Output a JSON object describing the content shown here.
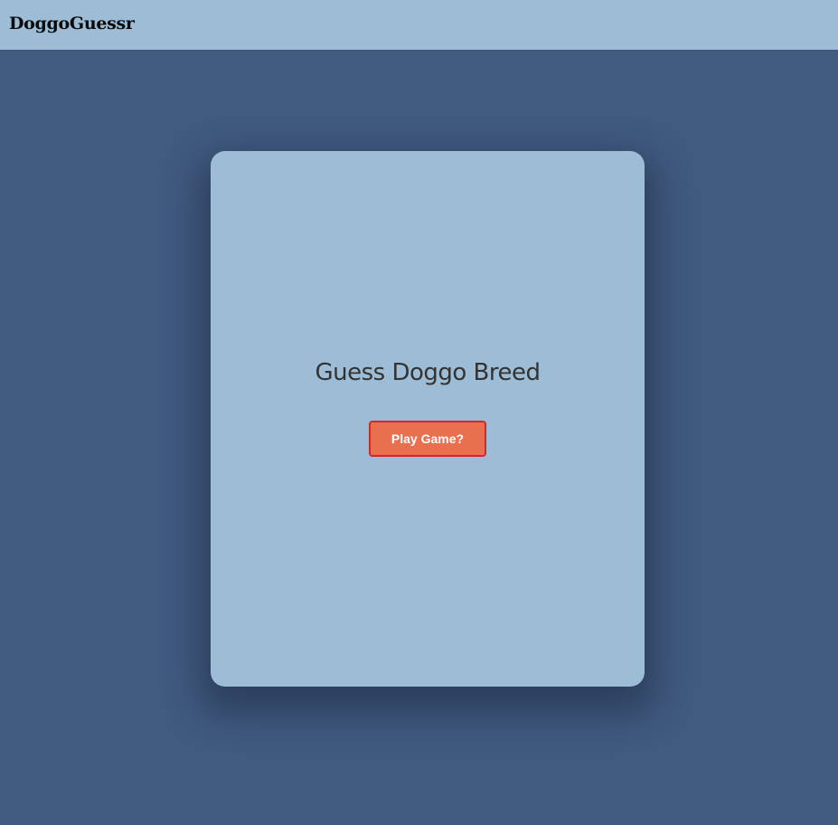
{
  "navbar": {
    "brand": "DoggoGuessr"
  },
  "card": {
    "title": "Guess Doggo Breed",
    "play_button_label": "Play Game?"
  },
  "colors": {
    "page_background": "#415a80",
    "navbar_background": "#9dbdd6",
    "card_background": "#9dbdd6",
    "button_fill": "#e8704f",
    "button_border": "#d1282b"
  }
}
